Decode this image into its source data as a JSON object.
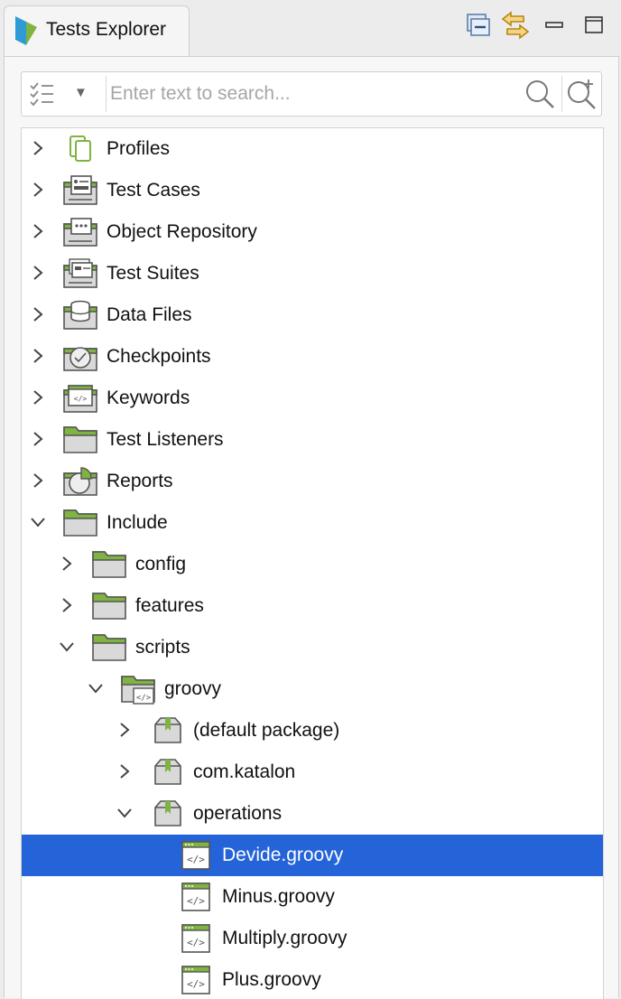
{
  "tab": {
    "title": "Tests Explorer",
    "icon": "katalon-logo-icon"
  },
  "toolbar": {
    "buttons": [
      {
        "name": "collapse-all-icon"
      },
      {
        "name": "link-with-editor-icon"
      },
      {
        "name": "minimize-icon"
      },
      {
        "name": "maximize-icon"
      }
    ]
  },
  "search": {
    "placeholder": "Enter text to search...",
    "value": "",
    "filter_icon": "checklist-filter-icon",
    "search_icon": "search-icon",
    "advanced_icon": "advanced-search-icon"
  },
  "colors": {
    "accent_green": "#7fb342",
    "selection": "#2563d8"
  },
  "tree": [
    {
      "label": "Profiles",
      "icon": "profiles-icon",
      "expanded": false
    },
    {
      "label": "Test Cases",
      "icon": "test-cases-icon",
      "expanded": false
    },
    {
      "label": "Object Repository",
      "icon": "object-repository-icon",
      "expanded": false
    },
    {
      "label": "Test Suites",
      "icon": "test-suites-icon",
      "expanded": false
    },
    {
      "label": "Data Files",
      "icon": "data-files-icon",
      "expanded": false
    },
    {
      "label": "Checkpoints",
      "icon": "checkpoints-icon",
      "expanded": false
    },
    {
      "label": "Keywords",
      "icon": "keywords-icon",
      "expanded": false
    },
    {
      "label": "Test Listeners",
      "icon": "folder-icon",
      "expanded": false
    },
    {
      "label": "Reports",
      "icon": "reports-icon",
      "expanded": false
    },
    {
      "label": "Include",
      "icon": "folder-icon",
      "expanded": true
    },
    {
      "label": "config",
      "icon": "folder-icon",
      "expanded": false
    },
    {
      "label": "features",
      "icon": "folder-icon",
      "expanded": false
    },
    {
      "label": "scripts",
      "icon": "folder-icon",
      "expanded": true
    },
    {
      "label": "groovy",
      "icon": "source-folder-icon",
      "expanded": true
    },
    {
      "label": "(default package)",
      "icon": "package-icon",
      "expanded": false
    },
    {
      "label": "com.katalon",
      "icon": "package-icon",
      "expanded": false
    },
    {
      "label": "operations",
      "icon": "package-icon",
      "expanded": true
    },
    {
      "label": "Devide.groovy",
      "icon": "groovy-file-icon",
      "selected": true
    },
    {
      "label": "Minus.groovy",
      "icon": "groovy-file-icon"
    },
    {
      "label": "Multiply.groovy",
      "icon": "groovy-file-icon"
    },
    {
      "label": "Plus.groovy",
      "icon": "groovy-file-icon"
    }
  ]
}
